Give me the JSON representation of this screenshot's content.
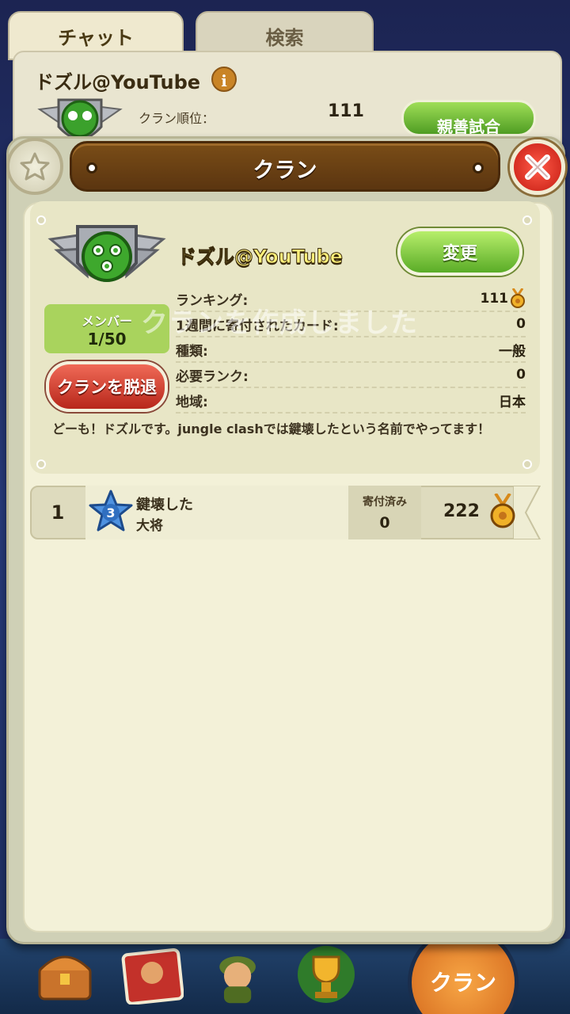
{
  "background": {
    "tabs": [
      {
        "label": "チャット"
      },
      {
        "label": "検索"
      }
    ],
    "clan_name": "ドズル@YouTube",
    "info_icon": "i",
    "rank_label": "クラン順位：",
    "rank_value": "111",
    "friendly_match_button": "親善試合"
  },
  "modal": {
    "title": "クラン",
    "clan": {
      "name": "ドズル@YouTube",
      "change_button": "変更",
      "member_label": "メンバー",
      "member_count": "1/50",
      "leave_button": "クランを脱退",
      "rows": [
        {
          "label": "ランキング:",
          "value": "111",
          "medal": true
        },
        {
          "label": "1週間に寄付されたカード:",
          "value": "0"
        },
        {
          "label": "種類:",
          "value": "一般"
        },
        {
          "label": "必要ランク:",
          "value": "0"
        },
        {
          "label": "地域:",
          "value": "日本"
        }
      ],
      "description": "どーも！ドズルです。jungle clashでは鍵壊したという名前でやってます！"
    },
    "toast": "クランを作成しました",
    "members": [
      {
        "rank": "1",
        "level": "3",
        "name": "鍵壊した",
        "title": "大将",
        "donated_label": "寄付済み",
        "donated": "0",
        "score": "222"
      }
    ]
  },
  "bottom_nav": {
    "clan_label": "クラン",
    "icons": [
      "treasure-chest-icon",
      "cards-icon",
      "soldier-icon",
      "trophy-icon"
    ]
  },
  "colors": {
    "title_bar": "#6b4113",
    "change_button": "#5aac27",
    "leave_button": "#c0291c",
    "member_box": "#a9d35d",
    "clan_name": "#fff07a"
  }
}
